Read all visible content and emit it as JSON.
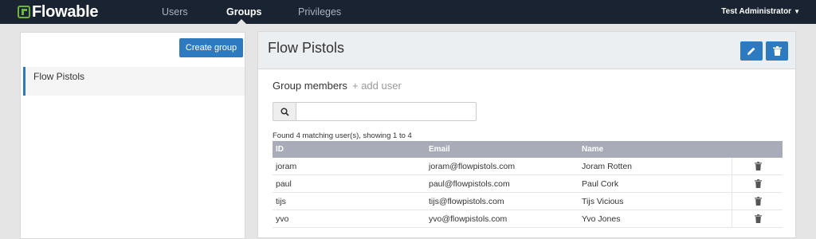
{
  "header": {
    "logo_text": "Flowable",
    "nav": [
      {
        "label": "Users",
        "active": false
      },
      {
        "label": "Groups",
        "active": true
      },
      {
        "label": "Privileges",
        "active": false
      }
    ],
    "user_menu": "Test Administrator",
    "brand_color": "#6db33f",
    "bar_color": "#1a2332"
  },
  "sidebar": {
    "create_button": "Create group",
    "groups": [
      {
        "label": "Flow Pistols",
        "selected": true
      }
    ]
  },
  "detail": {
    "title": "Flow Pistols",
    "edit_icon": "pencil-icon",
    "delete_icon": "trash-icon",
    "members_heading": "Group members",
    "add_user": "+ add user",
    "search": {
      "value": "",
      "placeholder": ""
    },
    "found_text": "Found 4 matching user(s), showing 1 to 4",
    "table": {
      "columns": [
        "ID",
        "Email",
        "Name"
      ],
      "rows": [
        {
          "id": "joram",
          "email": "joram@flowpistols.com",
          "name": "Joram Rotten"
        },
        {
          "id": "paul",
          "email": "paul@flowpistols.com",
          "name": "Paul Cork"
        },
        {
          "id": "tijs",
          "email": "tijs@flowpistols.com",
          "name": "Tijs Vicious"
        },
        {
          "id": "yvo",
          "email": "yvo@flowpistols.com",
          "name": "Yvo Jones"
        }
      ]
    },
    "accent_color": "#2d7ac0"
  }
}
